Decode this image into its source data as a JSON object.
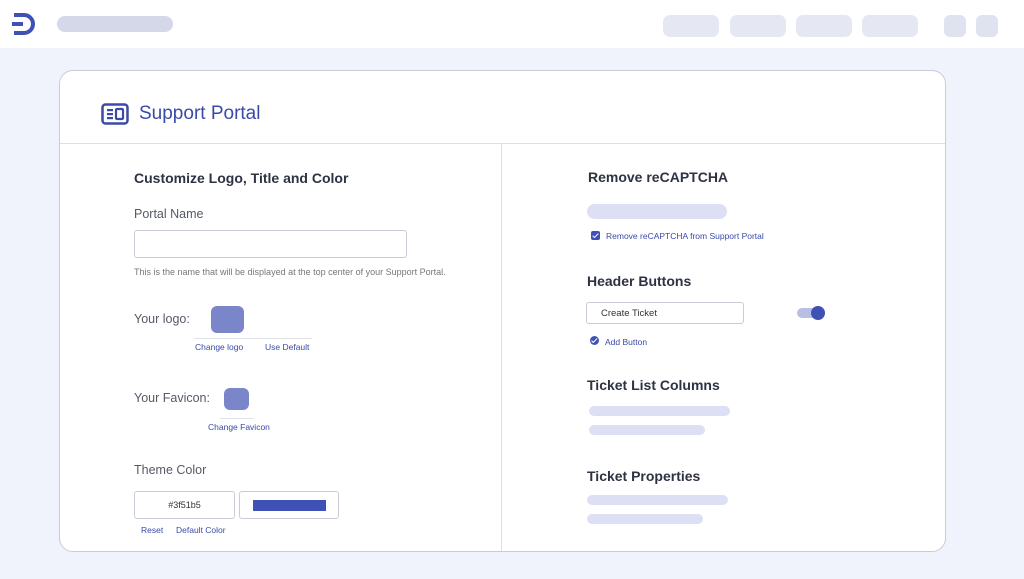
{
  "colors": {
    "accent": "#3f51b5",
    "logo_swatch": "#7a86c9",
    "page_bg": "#f0f2fc"
  },
  "topbar": {
    "logo_icon": "app-logo-icon",
    "nav_items": 4,
    "icon_buttons": 2
  },
  "header": {
    "icon": "portal-icon",
    "title": "Support Portal"
  },
  "left": {
    "section_title": "Customize Logo, Title and Color",
    "portal_name": {
      "label": "Portal Name",
      "value": "",
      "help": "This is the name that will be displayed at the top center of your Support Portal."
    },
    "logo": {
      "label": "Your logo:",
      "change": "Change logo",
      "default": "Use Default"
    },
    "favicon": {
      "label": "Your Favicon:",
      "change": "Change Favicon"
    },
    "theme": {
      "label": "Theme Color",
      "hex": "#3f51b5",
      "reset": "Reset",
      "default": "Default Color"
    }
  },
  "right": {
    "recaptcha": {
      "title": "Remove reCAPTCHA",
      "checkbox_label": "Remove reCAPTCHA from Support Portal",
      "checked": true
    },
    "header_buttons": {
      "title": "Header Buttons",
      "button_value": "Create Ticket",
      "toggle_on": true,
      "add_button": "Add Button"
    },
    "ticket_list": {
      "title": "Ticket List Columns"
    },
    "ticket_props": {
      "title": "Ticket Properties"
    }
  }
}
